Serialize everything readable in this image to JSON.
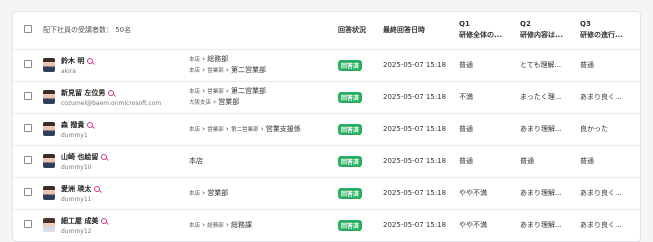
{
  "header": {
    "count_label": "配下社員の受講者数： 50名",
    "status": "回答状況",
    "last_answer": "最終回答日時",
    "q1": {
      "num": "Q1",
      "text": "研修全体の..."
    },
    "q2": {
      "num": "Q2",
      "text": "研修内容は..."
    },
    "q3": {
      "num": "Q3",
      "text": "研修の進行..."
    }
  },
  "rows": [
    {
      "name": "鈴木 明",
      "id": "akira",
      "dept1_small": "本店",
      "dept1": "総務部",
      "dept2_small": "本店",
      "dept2_mid": "営業部",
      "dept2": "第二営業部",
      "status": "回答済",
      "date": "2025-05-07 15:18",
      "q1": "普通",
      "q2": "とても理解...",
      "q3": "普通",
      "gender": "m"
    },
    {
      "name": "新見留 左位男",
      "id": "cozumel@baem.onmicrosoft.com",
      "dept1_small": "本店",
      "dept1_mid": "営業部",
      "dept1": "第二営業部",
      "dept2_small": "大阪支店",
      "dept2": "営業部",
      "status": "回答済",
      "date": "2025-05-07 15:18",
      "q1": "不満",
      "q2": "まったく理...",
      "q3": "あまり良く...",
      "gender": "m"
    },
    {
      "name": "森 撥貴",
      "id": "dummy1",
      "dept1_small": "本店",
      "dept1_mid": "営業部",
      "dept1_mid2": "第二営業部",
      "dept1": "営業支援係",
      "status": "回答済",
      "date": "2025-05-07 15:18",
      "q1": "普通",
      "q2": "あまり理解...",
      "q3": "良かった",
      "gender": "m"
    },
    {
      "name": "山崎 也絵留",
      "id": "dummy10",
      "dept1": "本店",
      "status": "回答済",
      "date": "2025-05-07 15:18",
      "q1": "普通",
      "q2": "普通",
      "q3": "普通",
      "gender": "m"
    },
    {
      "name": "愛洲 瑛太",
      "id": "dummy11",
      "dept1_small": "本店",
      "dept1": "営業部",
      "status": "回答済",
      "date": "2025-05-07 15:18",
      "q1": "やや不満",
      "q2": "あまり理解...",
      "q3": "あまり良く...",
      "gender": "m"
    },
    {
      "name": "細工屋 成美",
      "id": "dummy12",
      "dept1_small": "本店",
      "dept1_mid": "総務部",
      "dept1": "総務課",
      "status": "回答済",
      "date": "2025-05-07 15:18",
      "q1": "やや不満",
      "q2": "あまり理解...",
      "q3": "あまり良く...",
      "gender": "f"
    }
  ]
}
